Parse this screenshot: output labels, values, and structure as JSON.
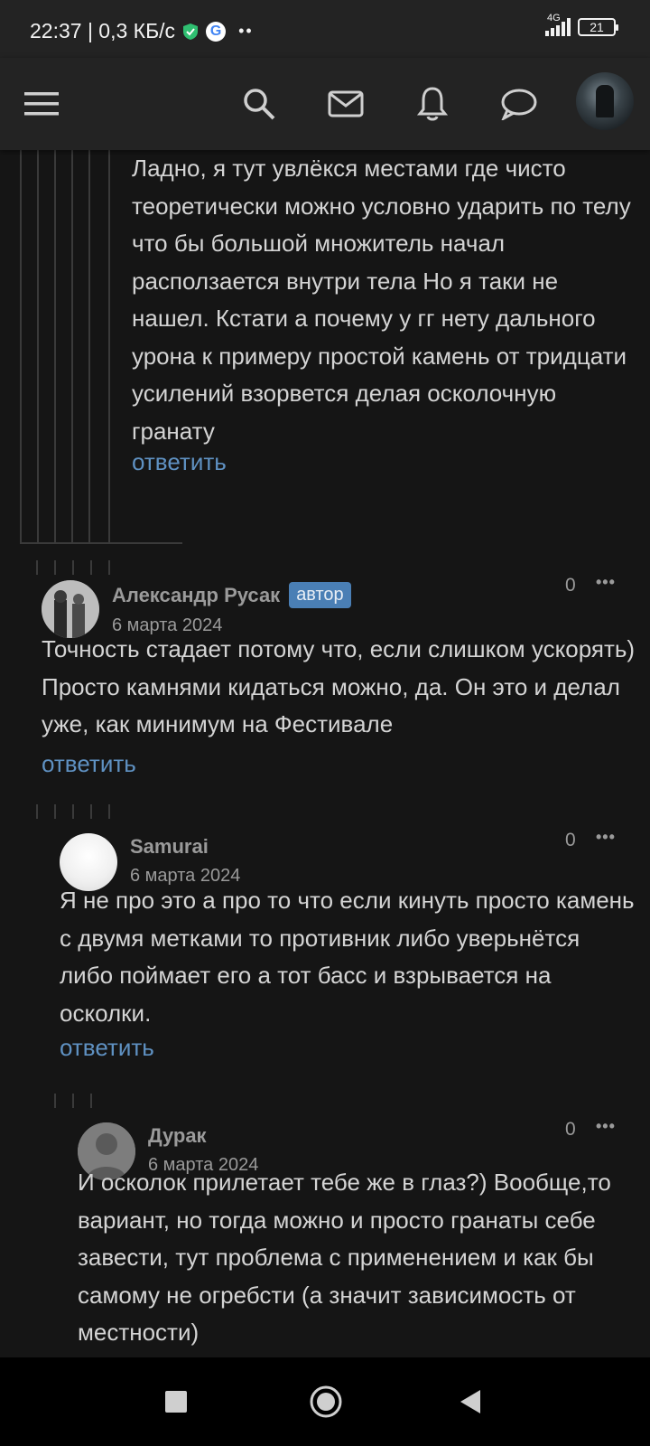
{
  "status": {
    "time_speed": "22:37 | 0,3 КБ/с",
    "network": "4G",
    "battery": "21"
  },
  "appbar": {
    "icons": [
      "menu-icon",
      "search-icon",
      "mail-icon",
      "bell-icon",
      "chat-icon"
    ]
  },
  "comments": [
    {
      "text": "Ладно, я тут увлёкся местами где чисто теоретически можно условно ударить по телу что бы большой множитель начал расползается внутри тела Но я таки не нашел. Кстати а почему у гг нету дального урона к примеру простой камень от тридцати усилений взорвется делая осколочную гранату",
      "reply": "ответить"
    },
    {
      "author": "Александр Русак",
      "badge": "автор",
      "date": "6 марта 2024",
      "score": "0",
      "more": "•••",
      "text": "Точность стадает потому что, если слишком ускорять) Просто камнями кидаться можно, да. Он это и делал уже, как минимум на Фестивале",
      "reply": "ответить"
    },
    {
      "author": "Samurai",
      "date": "6 марта 2024",
      "score": "0",
      "more": "•••",
      "text": "Я не про это а про то что если кинуть просто камень с двумя метками то противник либо уверьнётся либо поймает его а тот басс и взрывается на осколки.",
      "reply": "ответить"
    },
    {
      "author": "Дурак",
      "date": "6 марта 2024",
      "score": "0",
      "more": "•••",
      "text": "И осколок прилетает тебе же в глаз?) Вообще,то вариант, но тогда можно и просто гранаты себе завести, тут проблема с применением и как бы самому не огребсти (а значит зависимость от местности)"
    }
  ],
  "colors": {
    "background": "#151515",
    "bar": "#232323",
    "link": "#5f91c2",
    "badge": "#4a7fb5"
  }
}
